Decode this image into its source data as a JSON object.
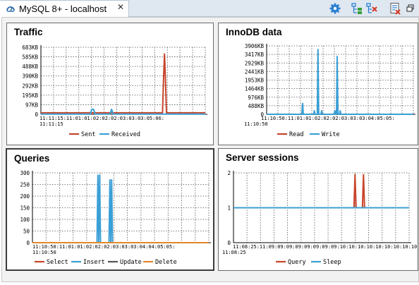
{
  "tab": {
    "title": "MySQL 8+ - localhost",
    "close_glyph": "✕"
  },
  "toolbar": {
    "buttons": [
      "gear-icon",
      "expand-tree-icon",
      "collapse-tree-icon",
      "report-icon",
      "restore-window-icon"
    ]
  },
  "colors": {
    "red": "#c8442a",
    "blue": "#3a9fd6",
    "orange": "#e0872a"
  },
  "chart_data": [
    {
      "type": "line",
      "title": "Traffic",
      "yticks": [
        "683KB",
        "585KB",
        "488KB",
        "390KB",
        "292KB",
        "195KB",
        "97KB",
        "0"
      ],
      "ylim": [
        0,
        683
      ],
      "y_unit": "KB",
      "x_start_label": "11:11:15",
      "x_overlap_labels": "11:11:15:11:01:01:02:02:02:03:03:03:05:06:",
      "series": [
        {
          "name": "Sent",
          "color": "#c8442a",
          "points": [
            [
              0,
              15
            ],
            [
              74,
              15
            ],
            [
              74.6,
              350
            ],
            [
              75.2,
              615
            ],
            [
              75.8,
              350
            ],
            [
              76.4,
              15
            ],
            [
              100,
              15
            ]
          ]
        },
        {
          "name": "Received",
          "color": "#3a9fd6",
          "points": [
            [
              0,
              2
            ],
            [
              30,
              2
            ],
            [
              31,
              50
            ],
            [
              32,
              50
            ],
            [
              33,
              2
            ],
            [
              42,
              2
            ],
            [
              43,
              50
            ],
            [
              44,
              2
            ],
            [
              100,
              2
            ]
          ]
        }
      ]
    },
    {
      "type": "line",
      "title": "InnoDB data",
      "yticks": [
        "3906KB",
        "3417KB",
        "2929KB",
        "2441KB",
        "1953KB",
        "1464KB",
        "976KB",
        "488KB",
        "0"
      ],
      "ylim": [
        0,
        3906
      ],
      "y_unit": "KB",
      "x_start_label": "11:10:50",
      "x_overlap_labels": "11:10:50:11:01:01:02:02:02:03:03:03:04:05:05:",
      "series": [
        {
          "name": "Read",
          "color": "#c8442a",
          "points": [
            [
              0,
              0
            ],
            [
              100,
              0
            ]
          ]
        },
        {
          "name": "Write",
          "color": "#3a9fd6",
          "points": [
            [
              0,
              0
            ],
            [
              24,
              0
            ],
            [
              24.5,
              620
            ],
            [
              25,
              0
            ],
            [
              32,
              0
            ],
            [
              32.5,
              200
            ],
            [
              33,
              0
            ],
            [
              34.5,
              0
            ],
            [
              35,
              3700
            ],
            [
              35.5,
              0
            ],
            [
              37,
              0
            ],
            [
              37.5,
              200
            ],
            [
              38,
              0
            ],
            [
              46,
              0
            ],
            [
              46.5,
              200
            ],
            [
              47,
              0
            ],
            [
              47.6,
              0
            ],
            [
              48.1,
              3300
            ],
            [
              48.6,
              0
            ],
            [
              49.6,
              0
            ],
            [
              50.1,
              200
            ],
            [
              50.6,
              0
            ],
            [
              100,
              0
            ]
          ]
        }
      ]
    },
    {
      "type": "line",
      "title": "Queries",
      "yticks": [
        "300",
        "250",
        "200",
        "150",
        "100",
        "50",
        "0"
      ],
      "ylim": [
        0,
        300
      ],
      "x_start_label": "11:10:50",
      "x_overlap_labels": "11:10:50:11:01:01:02:02:02:03:03:03:04:04:05:05:",
      "series": [
        {
          "name": "Select",
          "color": "#c8442a",
          "points": [
            [
              0,
              0
            ],
            [
              100,
              0
            ]
          ]
        },
        {
          "name": "Insert",
          "color": "#3a9fd6",
          "points": [
            [
              0,
              0
            ],
            [
              36.6,
              0
            ],
            [
              37.1,
              290
            ],
            [
              37.6,
              0
            ],
            [
              38.1,
              290
            ],
            [
              38.6,
              0
            ],
            [
              43.4,
              0
            ],
            [
              43.9,
              270
            ],
            [
              44.4,
              0
            ],
            [
              44.9,
              270
            ],
            [
              45.4,
              0
            ],
            [
              100,
              0
            ]
          ]
        },
        {
          "name": "Update",
          "color": "#555555",
          "points": [
            [
              0,
              0
            ],
            [
              100,
              0
            ]
          ]
        },
        {
          "name": "Delete",
          "color": "#e0872a",
          "points": [
            [
              0,
              0
            ],
            [
              100,
              0
            ]
          ]
        }
      ]
    },
    {
      "type": "line",
      "title": "Server sessions",
      "yticks": [
        "2",
        "1",
        "0"
      ],
      "ylim": [
        0,
        2
      ],
      "x_start_label": "11:08:25",
      "x_overlap_labels": "11:08:25:11:09:09:09:09:09:09:09:09:10:10:10:10:10:10:10:10:10:10:58",
      "series": [
        {
          "name": "Query",
          "color": "#c8442a",
          "points": [
            [
              0,
              1
            ],
            [
              68.6,
              1
            ],
            [
              69.2,
              1.95
            ],
            [
              69.8,
              1
            ],
            [
              73.4,
              1
            ],
            [
              74.0,
              1.95
            ],
            [
              74.6,
              1
            ],
            [
              100,
              1
            ]
          ]
        },
        {
          "name": "Sleep",
          "color": "#3a9fd6",
          "points": [
            [
              0,
              1
            ],
            [
              100,
              1
            ]
          ]
        }
      ]
    }
  ]
}
